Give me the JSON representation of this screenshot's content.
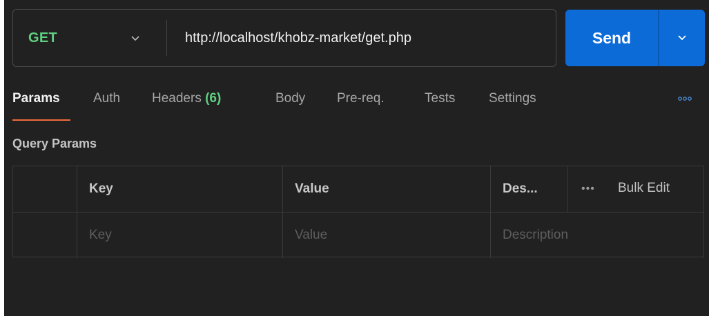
{
  "request": {
    "method": "GET",
    "url": "http://localhost/khobz-market/get.php",
    "send_label": "Send"
  },
  "tabs": [
    {
      "label": "Params",
      "active": true
    },
    {
      "label": "Auth"
    },
    {
      "label": "Headers",
      "count": "(6)"
    },
    {
      "label": "Body"
    },
    {
      "label": "Pre-req."
    },
    {
      "label": "Tests"
    },
    {
      "label": "Settings"
    }
  ],
  "query_params": {
    "title": "Query Params",
    "columns": {
      "key": "Key",
      "value": "Value",
      "description": "Des...",
      "bulk_edit": "Bulk Edit",
      "more": "•••"
    },
    "placeholders": {
      "key": "Key",
      "value": "Value",
      "description": "Description"
    }
  },
  "colors": {
    "background": "#212121",
    "method_get": "#5fcf80",
    "send_button": "#0d6bd8",
    "tab_active_underline": "#f26b3a",
    "headers_count": "#5fcf80"
  },
  "icons": {
    "method_dropdown": "chevron-down-icon",
    "send_dropdown": "chevron-down-icon",
    "tabs_more": "more-horizontal-icon"
  }
}
